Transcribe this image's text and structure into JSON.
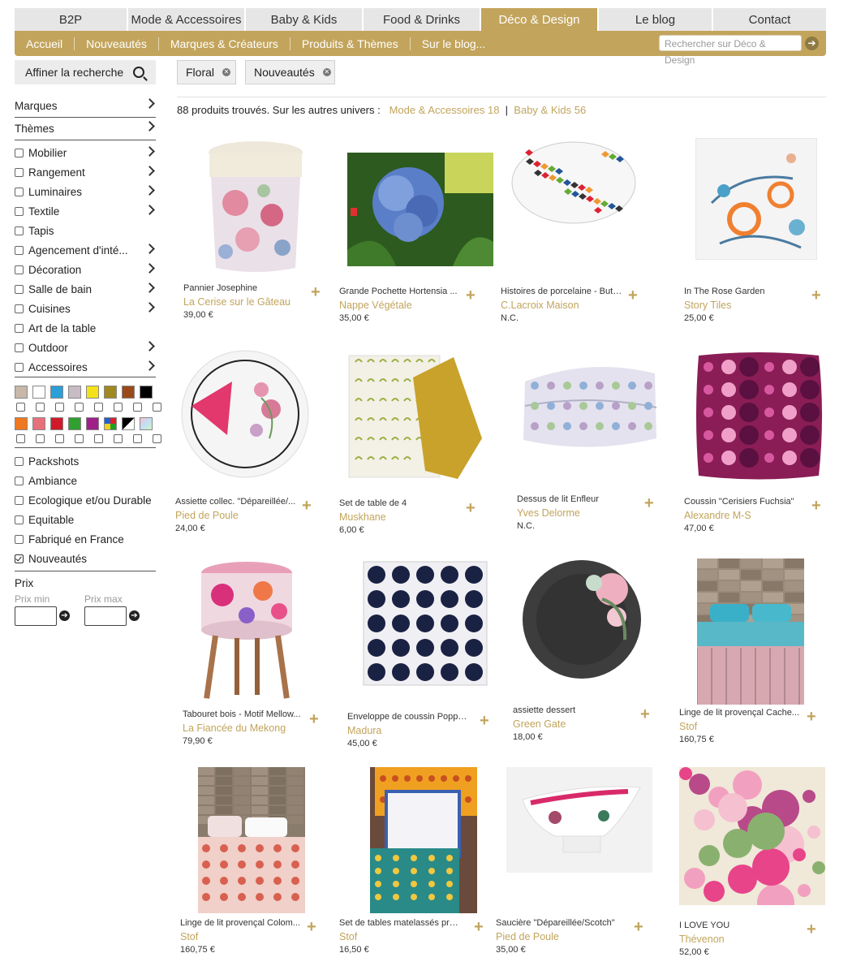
{
  "tabs": [
    {
      "label": "B2P",
      "w": 138,
      "active": false
    },
    {
      "label": "Mode & Accessoires",
      "w": 143,
      "active": false
    },
    {
      "label": "Baby & Kids",
      "w": 143,
      "active": false
    },
    {
      "label": "Food & Drinks",
      "w": 143,
      "active": false
    },
    {
      "label": "Déco & Design",
      "w": 143,
      "active": true
    },
    {
      "label": "Le blog",
      "w": 139,
      "active": false
    },
    {
      "label": "Contact",
      "w": 139,
      "active": false
    }
  ],
  "subnav": [
    "Accueil",
    "Nouveautés",
    "Marques & Créateurs",
    "Produits & Thèmes",
    "Sur le blog..."
  ],
  "search": {
    "placeholder": "Rechercher sur Déco & Design",
    "go_icon": "arrow-right-circle-icon"
  },
  "sidebar": {
    "refine_label": "Affiner la recherche",
    "refine_icon": "search-icon",
    "marques": "Marques",
    "themes": "Thèmes",
    "categories": [
      {
        "label": "Mobilier",
        "chev": true
      },
      {
        "label": "Rangement",
        "chev": true
      },
      {
        "label": "Luminaires",
        "chev": true
      },
      {
        "label": "Textile",
        "chev": true
      },
      {
        "label": "Tapis",
        "chev": false
      },
      {
        "label": "Agencement d'inté...",
        "chev": true
      },
      {
        "label": "Décoration",
        "chev": true
      },
      {
        "label": "Salle de bain",
        "chev": true
      },
      {
        "label": "Cuisines",
        "chev": true
      },
      {
        "label": "Art de la table",
        "chev": false
      },
      {
        "label": "Outdoor",
        "chev": true
      },
      {
        "label": "Accessoires",
        "chev": true
      }
    ],
    "swatches_row1": [
      "#c8b8a8",
      "#ffffff",
      "#2a9fd8",
      "#c7bcc4",
      "#f3e21a",
      "#a08820",
      "#9a4a1a",
      "#000000"
    ],
    "swatches_row2": [
      "#f07820",
      "#e8707a",
      "#d01a2a",
      "#30a030",
      "#a0208a",
      "multi",
      "bw",
      "pastel"
    ],
    "labels": [
      {
        "label": "Packshots",
        "checked": false
      },
      {
        "label": "Ambiance",
        "checked": false
      },
      {
        "label": "Ecologique et/ou Durable",
        "checked": false
      },
      {
        "label": "Equitable",
        "checked": false
      },
      {
        "label": "Fabriqué en France",
        "checked": false
      },
      {
        "label": "Nouveautés",
        "checked": true
      }
    ],
    "price_title": "Prix",
    "price_min": "Prix min",
    "price_max": "Prix max"
  },
  "chips": [
    {
      "label": "Floral"
    },
    {
      "label": "Nouveautés"
    }
  ],
  "results": {
    "text": "88 produits trouvés. Sur les autres univers :",
    "link1": "Mode & Accessoires 18",
    "sep": "|",
    "link2": "Baby & Kids 56"
  },
  "products": [
    {
      "name": "Pannier Josephine",
      "brand": "La Cerise sur le Gâteau",
      "price": "39,00 €",
      "art": "basket"
    },
    {
      "name": "Grande Pochette Hortensia ...",
      "brand": "Nappe Végétale",
      "price": "35,00 €",
      "art": "hydrangea"
    },
    {
      "name": "Histoires de porcelaine - Butt...",
      "brand": "C.Lacroix Maison",
      "price": "N.C.",
      "art": "platter"
    },
    {
      "name": "In The Rose Garden",
      "brand": "Story Tiles",
      "price": "25,00 €",
      "art": "tile"
    },
    {
      "name": "Assiette collec. \"Dépareillée/...",
      "brand": "Pied de Poule",
      "price": "24,00 €",
      "art": "plate"
    },
    {
      "name": "Set de table de 4",
      "brand": "Muskhane",
      "price": "6,00 €",
      "art": "placemat"
    },
    {
      "name": "Dessus de lit Enfleur",
      "brand": "Yves Delorme",
      "price": "N.C.",
      "art": "quilt"
    },
    {
      "name": "Coussin \"Cerisiers Fuchsia\"",
      "brand": "Alexandre M-S",
      "price": "47,00 €",
      "art": "cushion-pink"
    },
    {
      "name": "Tabouret bois - Motif Mellow...",
      "brand": "La Fiancée du Mekong",
      "price": "79,90 €",
      "art": "stool"
    },
    {
      "name": "Enveloppe de coussin Poppy...",
      "brand": "Madura",
      "price": "45,00 €",
      "art": "cushion-navy"
    },
    {
      "name": "assiette dessert",
      "brand": "Green Gate",
      "price": "18,00 €",
      "art": "dark-plate"
    },
    {
      "name": "Linge de lit provençal Cache...",
      "brand": "Stof",
      "price": "160,75 €",
      "art": "bed1"
    },
    {
      "name": "Linge de lit provençal Colom...",
      "brand": "Stof",
      "price": "160,75 €",
      "art": "bed2"
    },
    {
      "name": "Set de tables matelassés pro...",
      "brand": "Stof",
      "price": "16,50 €",
      "art": "tablesets"
    },
    {
      "name": "Saucière \"Dépareillée/Scotch\"",
      "brand": "Pied de Poule",
      "price": "35,00 €",
      "art": "gravyboat"
    },
    {
      "name": "I LOVE YOU",
      "brand": "Thévenon",
      "price": "52,00 €",
      "art": "floralfabric"
    }
  ]
}
